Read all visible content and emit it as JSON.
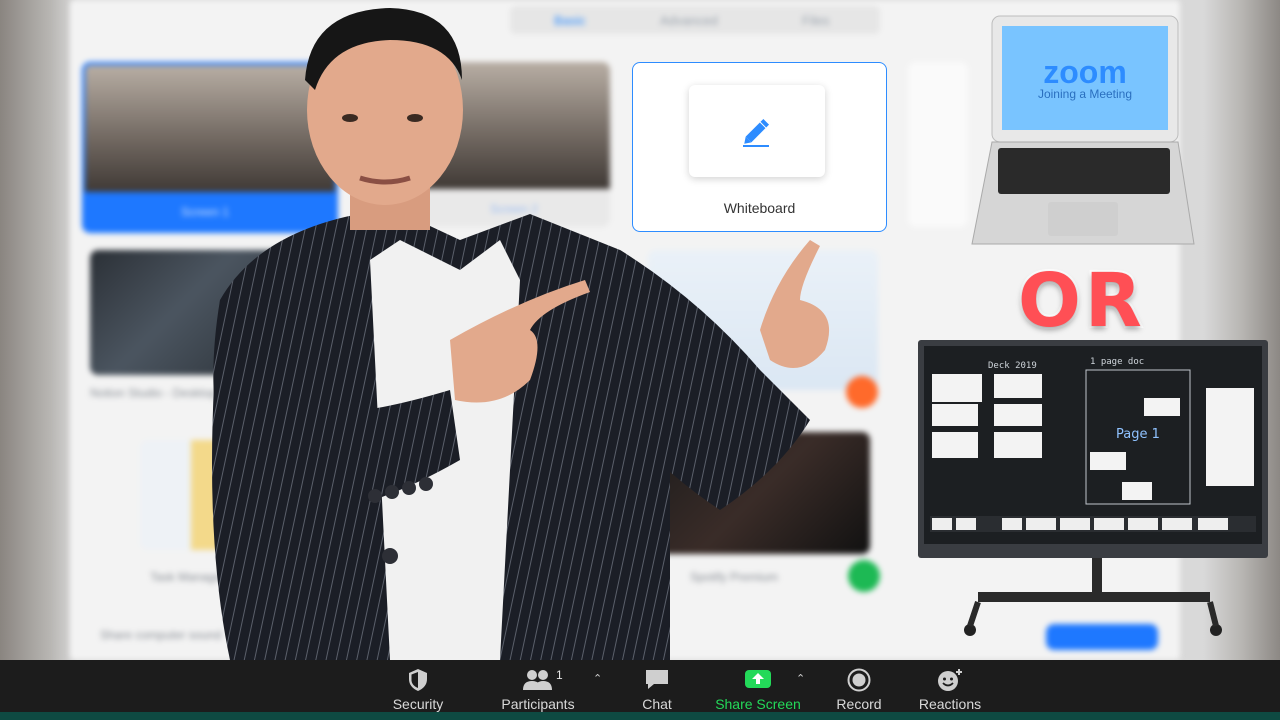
{
  "dialog": {
    "tabs": [
      "Basic",
      "Advanced",
      "Files"
    ],
    "tiles": [
      {
        "caption": "Screen 1"
      },
      {
        "caption": "Screen 2"
      },
      {
        "caption": "Whiteboard"
      },
      {
        "caption": "Notion Studio - Desktop"
      },
      {
        "caption": "Task Manager"
      },
      {
        "caption": "Spotify Premium"
      }
    ],
    "checkbox_label": "Share computer sound",
    "accent_color": "#1e78ff"
  },
  "laptop": {
    "logo": "zoom",
    "subtitle": "Joining a Meeting"
  },
  "overlay_text": "OR",
  "whiteboard_display": {
    "title": "Deck 2019",
    "panel_title": "1 page doc",
    "page_label": "Page 1"
  },
  "toolbar": {
    "participants_count": "1",
    "items": [
      {
        "label": "Security",
        "icon": "shield-icon"
      },
      {
        "label": "Participants",
        "icon": "people-icon"
      },
      {
        "label": "Chat",
        "icon": "chat-bubble-icon"
      },
      {
        "label": "Share Screen",
        "icon": "share-screen-icon"
      },
      {
        "label": "Record",
        "icon": "record-icon"
      },
      {
        "label": "Reactions",
        "icon": "emoji-add-icon"
      }
    ],
    "share_color": "#23d959",
    "background_color": "#1c1c1c"
  }
}
